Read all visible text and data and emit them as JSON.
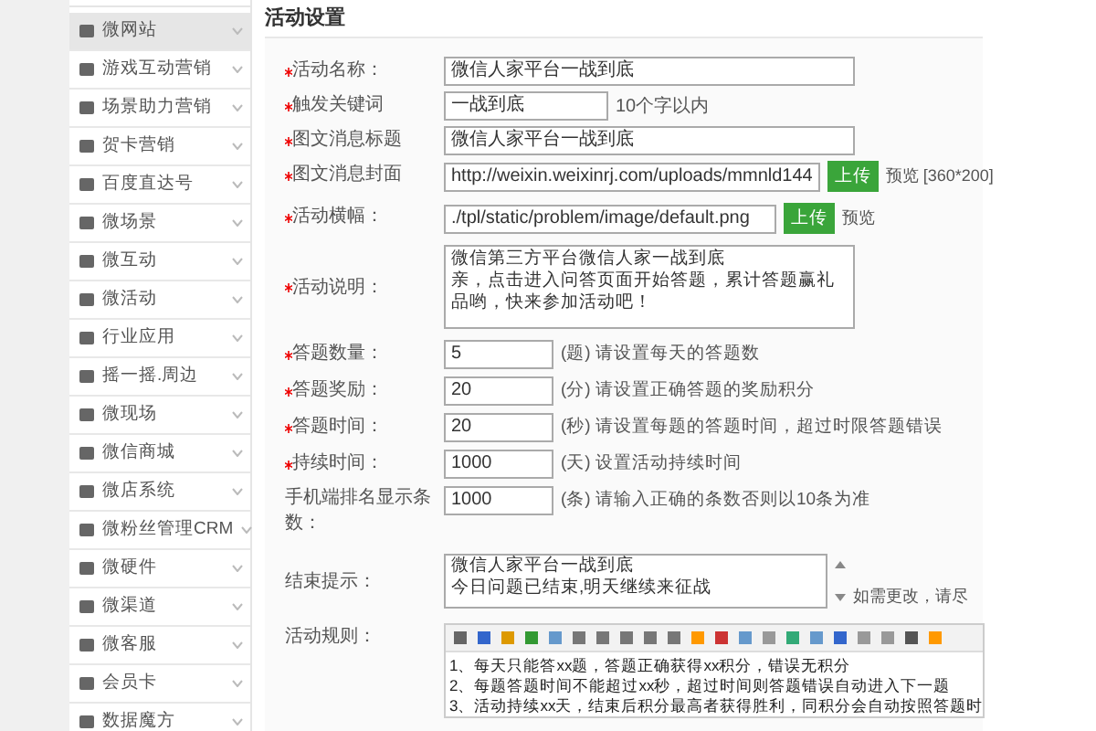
{
  "sidebar": {
    "items": [
      {
        "label": "微网站",
        "selected": true
      },
      {
        "label": "游戏互动营销",
        "selected": false
      },
      {
        "label": "场景助力营销",
        "selected": false
      },
      {
        "label": "贺卡营销",
        "selected": false
      },
      {
        "label": "百度直达号",
        "selected": false
      },
      {
        "label": "微场景",
        "selected": false
      },
      {
        "label": "微互动",
        "selected": false
      },
      {
        "label": "微活动",
        "selected": false
      },
      {
        "label": "行业应用",
        "selected": false
      },
      {
        "label": "摇一摇.周边",
        "selected": false
      },
      {
        "label": "微现场",
        "selected": false
      },
      {
        "label": "微信商城",
        "selected": false
      },
      {
        "label": "微店系统",
        "selected": false
      },
      {
        "label": "微粉丝管理CRM",
        "selected": false
      },
      {
        "label": "微硬件",
        "selected": false
      },
      {
        "label": "微渠道",
        "selected": false
      },
      {
        "label": "微客服",
        "selected": false
      },
      {
        "label": "会员卡",
        "selected": false
      },
      {
        "label": "数据魔方",
        "selected": false
      }
    ]
  },
  "section_title": "活动设置",
  "form": [
    {
      "kind": "text",
      "label": "活动名称：",
      "required": true,
      "value": "微信人家平台一战到底"
    },
    {
      "kind": "short",
      "label": "触发关键词",
      "required": true,
      "value": "一战到底",
      "hint": "10个字以内"
    },
    {
      "kind": "text",
      "label": "图文消息标题",
      "required": true,
      "value": "微信人家平台一战到底"
    },
    {
      "kind": "upload",
      "label": "图文消息封面",
      "required": true,
      "value": "http://weixin.weixinrj.com/uploads/mmnld144",
      "button": "上传",
      "hint": "预览 [360*200]"
    },
    {
      "kind": "upload",
      "label": "活动横幅：",
      "required": true,
      "value": "./tpl/static/problem/image/default.png",
      "button": "上传",
      "hint": "预览"
    },
    {
      "kind": "textarea",
      "label": "活动说明：",
      "required": true,
      "lines": [
        "微信第三方平台微信人家一战到底",
        "亲，点击进入问答页面开始答题，累计答题赢礼品哟，快来参加活动吧！"
      ]
    },
    {
      "kind": "number",
      "label": "答题数量：",
      "required": true,
      "value": "5",
      "hint": "(题) 请设置每天的答题数"
    },
    {
      "kind": "number",
      "label": "答题奖励：",
      "required": true,
      "value": "20",
      "hint": "(分) 请设置正确答题的奖励积分"
    },
    {
      "kind": "number",
      "label": "答题时间：",
      "required": true,
      "value": "20",
      "hint": "(秒) 请设置每题的答题时间，超过时限答题错误"
    },
    {
      "kind": "number",
      "label": "持续时间：",
      "required": true,
      "value": "1000",
      "hint": "(天) 设置活动持续时间"
    },
    {
      "kind": "number",
      "label": "手机端排名显示条数：",
      "required": false,
      "value": "1000",
      "hint": "(条) 请输入正确的条数否则以10条为准"
    },
    {
      "kind": "scrolltext",
      "label": "结束提示：",
      "required": false,
      "lines": [
        "微信人家平台一战到底",
        "今日问题已结束,明天继续来征战"
      ],
      "hint": "如需更改，请尽"
    },
    {
      "kind": "editor",
      "label": "活动规则：",
      "required": false,
      "lines": [
        "1、每天只能答xx题，答题正确获得xx积分，错误无积分",
        "2、每题答题时间不能超过xx秒，超过时间则答题错误自动进入下一题",
        "3、活动持续xx天，结束后积分最高者获得胜利，同积分会自动按照答题时"
      ]
    }
  ]
}
